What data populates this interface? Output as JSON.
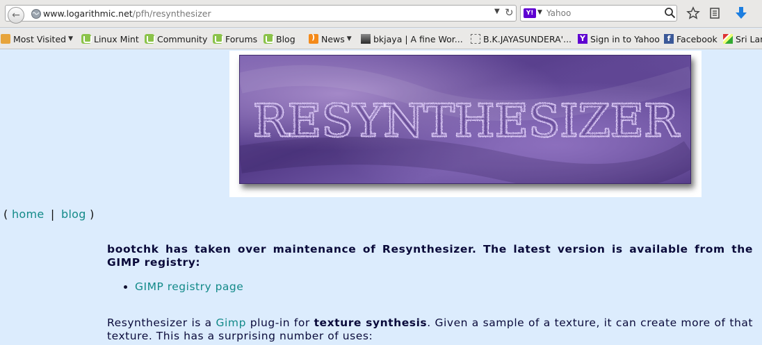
{
  "browser": {
    "url_host": "www.logarithmic.net",
    "url_path": "/pfh/resynthesizer",
    "search_placeholder": "Yahoo",
    "search_engine_badge": "Y!",
    "bookmarks": [
      {
        "label": "Most Visited",
        "icon": "folder-icon",
        "dropdown": true
      },
      {
        "label": "Linux Mint",
        "icon": "mint-icon"
      },
      {
        "label": "Community",
        "icon": "mint-icon"
      },
      {
        "label": "Forums",
        "icon": "mint-icon"
      },
      {
        "label": "Blog",
        "icon": "mint-icon"
      },
      {
        "label": "News",
        "icon": "rss-icon",
        "dropdown": true
      },
      {
        "label": "bkjaya | A fine Wor...",
        "icon": "image-icon"
      },
      {
        "label": "B.K.JAYASUNDERA'...",
        "icon": "page-icon"
      },
      {
        "label": "Sign in to Yahoo",
        "icon": "yahoo-icon"
      },
      {
        "label": "Facebook",
        "icon": "facebook-icon"
      },
      {
        "label": "Sri Lar",
        "icon": "flag-icon"
      }
    ]
  },
  "page": {
    "banner_title": "RESYNTHESIZER",
    "nav": {
      "open": "(",
      "home": "home",
      "separator": "|",
      "blog": "blog",
      "close": ")"
    },
    "notice": "bootchk has taken over maintenance of Resynthesizer. The latest version is available from the GIMP registry:",
    "registry_link": "GIMP registry page",
    "intro": {
      "part1": "Resynthesizer is a ",
      "gimp_link": "Gimp",
      "part2": " plug-in for ",
      "bold": "texture synthesis",
      "part3": ". Given a sample of a texture, it can create more of that texture. This has a surprising number of uses:"
    }
  },
  "colors": {
    "page_background": "#dcecfd",
    "link": "#138a89",
    "text": "#0a0a3a"
  }
}
